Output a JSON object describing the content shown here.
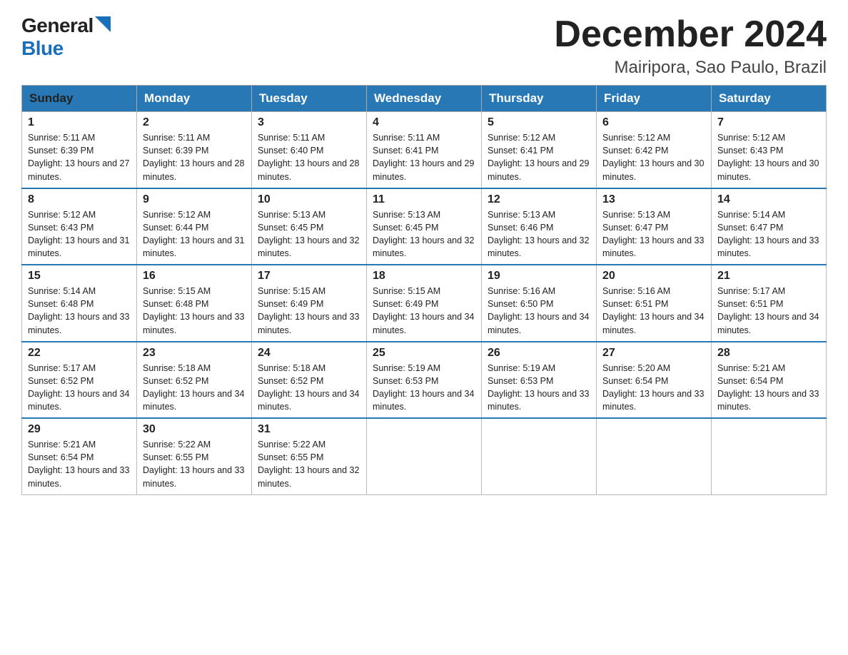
{
  "logo": {
    "general": "General",
    "blue": "Blue"
  },
  "title": "December 2024",
  "location": "Mairipora, Sao Paulo, Brazil",
  "days_of_week": [
    "Sunday",
    "Monday",
    "Tuesday",
    "Wednesday",
    "Thursday",
    "Friday",
    "Saturday"
  ],
  "weeks": [
    [
      {
        "day": "1",
        "sunrise": "5:11 AM",
        "sunset": "6:39 PM",
        "daylight": "13 hours and 27 minutes."
      },
      {
        "day": "2",
        "sunrise": "5:11 AM",
        "sunset": "6:39 PM",
        "daylight": "13 hours and 28 minutes."
      },
      {
        "day": "3",
        "sunrise": "5:11 AM",
        "sunset": "6:40 PM",
        "daylight": "13 hours and 28 minutes."
      },
      {
        "day": "4",
        "sunrise": "5:11 AM",
        "sunset": "6:41 PM",
        "daylight": "13 hours and 29 minutes."
      },
      {
        "day": "5",
        "sunrise": "5:12 AM",
        "sunset": "6:41 PM",
        "daylight": "13 hours and 29 minutes."
      },
      {
        "day": "6",
        "sunrise": "5:12 AM",
        "sunset": "6:42 PM",
        "daylight": "13 hours and 30 minutes."
      },
      {
        "day": "7",
        "sunrise": "5:12 AM",
        "sunset": "6:43 PM",
        "daylight": "13 hours and 30 minutes."
      }
    ],
    [
      {
        "day": "8",
        "sunrise": "5:12 AM",
        "sunset": "6:43 PM",
        "daylight": "13 hours and 31 minutes."
      },
      {
        "day": "9",
        "sunrise": "5:12 AM",
        "sunset": "6:44 PM",
        "daylight": "13 hours and 31 minutes."
      },
      {
        "day": "10",
        "sunrise": "5:13 AM",
        "sunset": "6:45 PM",
        "daylight": "13 hours and 32 minutes."
      },
      {
        "day": "11",
        "sunrise": "5:13 AM",
        "sunset": "6:45 PM",
        "daylight": "13 hours and 32 minutes."
      },
      {
        "day": "12",
        "sunrise": "5:13 AM",
        "sunset": "6:46 PM",
        "daylight": "13 hours and 32 minutes."
      },
      {
        "day": "13",
        "sunrise": "5:13 AM",
        "sunset": "6:47 PM",
        "daylight": "13 hours and 33 minutes."
      },
      {
        "day": "14",
        "sunrise": "5:14 AM",
        "sunset": "6:47 PM",
        "daylight": "13 hours and 33 minutes."
      }
    ],
    [
      {
        "day": "15",
        "sunrise": "5:14 AM",
        "sunset": "6:48 PM",
        "daylight": "13 hours and 33 minutes."
      },
      {
        "day": "16",
        "sunrise": "5:15 AM",
        "sunset": "6:48 PM",
        "daylight": "13 hours and 33 minutes."
      },
      {
        "day": "17",
        "sunrise": "5:15 AM",
        "sunset": "6:49 PM",
        "daylight": "13 hours and 33 minutes."
      },
      {
        "day": "18",
        "sunrise": "5:15 AM",
        "sunset": "6:49 PM",
        "daylight": "13 hours and 34 minutes."
      },
      {
        "day": "19",
        "sunrise": "5:16 AM",
        "sunset": "6:50 PM",
        "daylight": "13 hours and 34 minutes."
      },
      {
        "day": "20",
        "sunrise": "5:16 AM",
        "sunset": "6:51 PM",
        "daylight": "13 hours and 34 minutes."
      },
      {
        "day": "21",
        "sunrise": "5:17 AM",
        "sunset": "6:51 PM",
        "daylight": "13 hours and 34 minutes."
      }
    ],
    [
      {
        "day": "22",
        "sunrise": "5:17 AM",
        "sunset": "6:52 PM",
        "daylight": "13 hours and 34 minutes."
      },
      {
        "day": "23",
        "sunrise": "5:18 AM",
        "sunset": "6:52 PM",
        "daylight": "13 hours and 34 minutes."
      },
      {
        "day": "24",
        "sunrise": "5:18 AM",
        "sunset": "6:52 PM",
        "daylight": "13 hours and 34 minutes."
      },
      {
        "day": "25",
        "sunrise": "5:19 AM",
        "sunset": "6:53 PM",
        "daylight": "13 hours and 34 minutes."
      },
      {
        "day": "26",
        "sunrise": "5:19 AM",
        "sunset": "6:53 PM",
        "daylight": "13 hours and 33 minutes."
      },
      {
        "day": "27",
        "sunrise": "5:20 AM",
        "sunset": "6:54 PM",
        "daylight": "13 hours and 33 minutes."
      },
      {
        "day": "28",
        "sunrise": "5:21 AM",
        "sunset": "6:54 PM",
        "daylight": "13 hours and 33 minutes."
      }
    ],
    [
      {
        "day": "29",
        "sunrise": "5:21 AM",
        "sunset": "6:54 PM",
        "daylight": "13 hours and 33 minutes."
      },
      {
        "day": "30",
        "sunrise": "5:22 AM",
        "sunset": "6:55 PM",
        "daylight": "13 hours and 33 minutes."
      },
      {
        "day": "31",
        "sunrise": "5:22 AM",
        "sunset": "6:55 PM",
        "daylight": "13 hours and 32 minutes."
      },
      null,
      null,
      null,
      null
    ]
  ]
}
